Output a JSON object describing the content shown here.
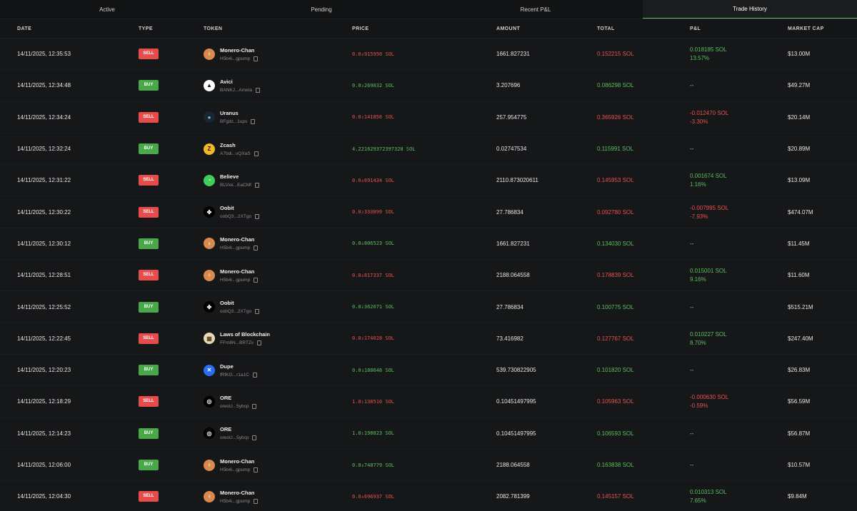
{
  "tabs": [
    {
      "label": "Active",
      "active": false
    },
    {
      "label": "Pending",
      "active": false
    },
    {
      "label": "Recent P&L",
      "active": false
    },
    {
      "label": "Trade History",
      "active": true
    }
  ],
  "columns": {
    "date": "DATE",
    "type": "TYPE",
    "token": "TOKEN",
    "price": "PRICE",
    "amount": "AMOUNT",
    "total": "TOTAL",
    "pnl": "P&L",
    "market_cap": "MARKET CAP"
  },
  "colors": {
    "sell": "#e74c4c",
    "buy": "#48a84a",
    "loss": "#e9524f",
    "profit": "#5cbf5e"
  },
  "rows": [
    {
      "date": "14/11/2025, 12:35:53",
      "type": "SELL",
      "token": "Monero-Chan",
      "addr": "H5b4i...gpump",
      "icon": "monero-chan-icon",
      "price": "0.0₄915950 SOL",
      "amount": "1661.827231",
      "total": "0.152215 SOL",
      "pnl_sol": "0.018185 SOL",
      "pnl_pct": "13.57%",
      "pnl_dir": "profit",
      "market_cap": "$13.00M"
    },
    {
      "date": "14/11/2025, 12:34:48",
      "type": "BUY",
      "token": "Avici",
      "addr": "BANKJ...Ameta",
      "icon": "avici-icon",
      "price": "0.0₂269032 SOL",
      "amount": "3.207696",
      "total": "0.086298 SOL",
      "pnl_sol": "--",
      "pnl_pct": "",
      "pnl_dir": "none",
      "market_cap": "$49.27M"
    },
    {
      "date": "14/11/2025, 12:34:24",
      "type": "SELL",
      "token": "Uranus",
      "addr": "BFgdz...1ups",
      "icon": "uranus-icon",
      "price": "0.0₂141856 SOL",
      "amount": "257.954775",
      "total": "0.365926 SOL",
      "pnl_sol": "-0.012470 SOL",
      "pnl_pct": "-3.30%",
      "pnl_dir": "loss",
      "market_cap": "$20.14M"
    },
    {
      "date": "14/11/2025, 12:32:24",
      "type": "BUY",
      "token": "Zcash",
      "addr": "A7bdi...vQXaS",
      "icon": "zcash-icon",
      "price": "4.221629372397328 SOL",
      "amount": "0.02747534",
      "total": "0.115991 SOL",
      "pnl_sol": "--",
      "pnl_pct": "",
      "pnl_dir": "none",
      "market_cap": "$20.89M"
    },
    {
      "date": "14/11/2025, 12:31:22",
      "type": "SELL",
      "token": "Believe",
      "addr": "BLVxe...EaCMf",
      "icon": "believe-icon",
      "price": "0.0₄691434 SOL",
      "amount": "2110.873020611",
      "total": "0.145953 SOL",
      "pnl_sol": "0.001674 SOL",
      "pnl_pct": "1.16%",
      "pnl_dir": "profit",
      "market_cap": "$13.09M"
    },
    {
      "date": "14/11/2025, 12:30:22",
      "type": "SELL",
      "token": "Oobit",
      "addr": "oobQ3...2XTgo",
      "icon": "oobit-icon",
      "price": "0.0₂333899 SOL",
      "amount": "27.786834",
      "total": "0.092780 SOL",
      "pnl_sol": "-0.007995 SOL",
      "pnl_pct": "-7.93%",
      "pnl_dir": "loss",
      "market_cap": "$474.07M"
    },
    {
      "date": "14/11/2025, 12:30:12",
      "type": "BUY",
      "token": "Monero-Chan",
      "addr": "H5b4i...gpump",
      "icon": "monero-chan-icon",
      "price": "0.0₄806523 SOL",
      "amount": "1661.827231",
      "total": "0.134030 SOL",
      "pnl_sol": "--",
      "pnl_pct": "",
      "pnl_dir": "none",
      "market_cap": "$11.45M"
    },
    {
      "date": "14/11/2025, 12:28:51",
      "type": "SELL",
      "token": "Monero-Chan",
      "addr": "H5b4i...gpump",
      "icon": "monero-chan-icon",
      "price": "0.0₄817337 SOL",
      "amount": "2188.064558",
      "total": "0.178839 SOL",
      "pnl_sol": "0.015001 SOL",
      "pnl_pct": "9.16%",
      "pnl_dir": "profit",
      "market_cap": "$11.60M"
    },
    {
      "date": "14/11/2025, 12:25:52",
      "type": "BUY",
      "token": "Oobit",
      "addr": "oobQ3...2XTgo",
      "icon": "oobit-icon",
      "price": "0.0₂362671 SOL",
      "amount": "27.786834",
      "total": "0.100775 SOL",
      "pnl_sol": "--",
      "pnl_pct": "",
      "pnl_dir": "none",
      "market_cap": "$515.21M"
    },
    {
      "date": "14/11/2025, 12:22:45",
      "type": "SELL",
      "token": "Laws of Blockchain",
      "addr": "FFm8N...BRTZv",
      "icon": "laws-of-blockchain-icon",
      "price": "0.0₂174028 SOL",
      "amount": "73.416982",
      "total": "0.127767 SOL",
      "pnl_sol": "0.010227 SOL",
      "pnl_pct": "8.70%",
      "pnl_dir": "profit",
      "market_cap": "$247.40M"
    },
    {
      "date": "14/11/2025, 12:20:23",
      "type": "BUY",
      "token": "Dupe",
      "addr": "fRfKG...r1a1C",
      "icon": "dupe-icon",
      "price": "0.0₃188648 SOL",
      "amount": "539.730822905",
      "total": "0.101820 SOL",
      "pnl_sol": "--",
      "pnl_pct": "",
      "pnl_dir": "none",
      "market_cap": "$26.83M"
    },
    {
      "date": "14/11/2025, 12:18:29",
      "type": "SELL",
      "token": "ORE",
      "addr": "oreoU...5ybcp",
      "icon": "ore-icon",
      "price": "1.0₁138510 SOL",
      "amount": "0.10451497995",
      "total": "0.105963 SOL",
      "pnl_sol": "-0.000630 SOL",
      "pnl_pct": "-0.59%",
      "pnl_dir": "loss",
      "market_cap": "$56.59M"
    },
    {
      "date": "14/11/2025, 12:14:23",
      "type": "BUY",
      "token": "ORE",
      "addr": "oreoU...5ybcp",
      "icon": "ore-icon",
      "price": "1.0₁198823 SOL",
      "amount": "0.10451497995",
      "total": "0.106593 SOL",
      "pnl_sol": "--",
      "pnl_pct": "",
      "pnl_dir": "none",
      "market_cap": "$56.87M"
    },
    {
      "date": "14/11/2025, 12:06:00",
      "type": "BUY",
      "token": "Monero-Chan",
      "addr": "H5b4i...gpump",
      "icon": "monero-chan-icon",
      "price": "0.0₄748779 SOL",
      "amount": "2188.064558",
      "total": "0.163838 SOL",
      "pnl_sol": "--",
      "pnl_pct": "",
      "pnl_dir": "none",
      "market_cap": "$10.57M"
    },
    {
      "date": "14/11/2025, 12:04:30",
      "type": "SELL",
      "token": "Monero-Chan",
      "addr": "H5b4i...gpump",
      "icon": "monero-chan-icon",
      "price": "0.0₄696937 SOL",
      "amount": "2082.781399",
      "total": "0.145157 SOL",
      "pnl_sol": "0.010313 SOL",
      "pnl_pct": "7.65%",
      "pnl_dir": "profit",
      "market_cap": "$9.84M"
    }
  ]
}
